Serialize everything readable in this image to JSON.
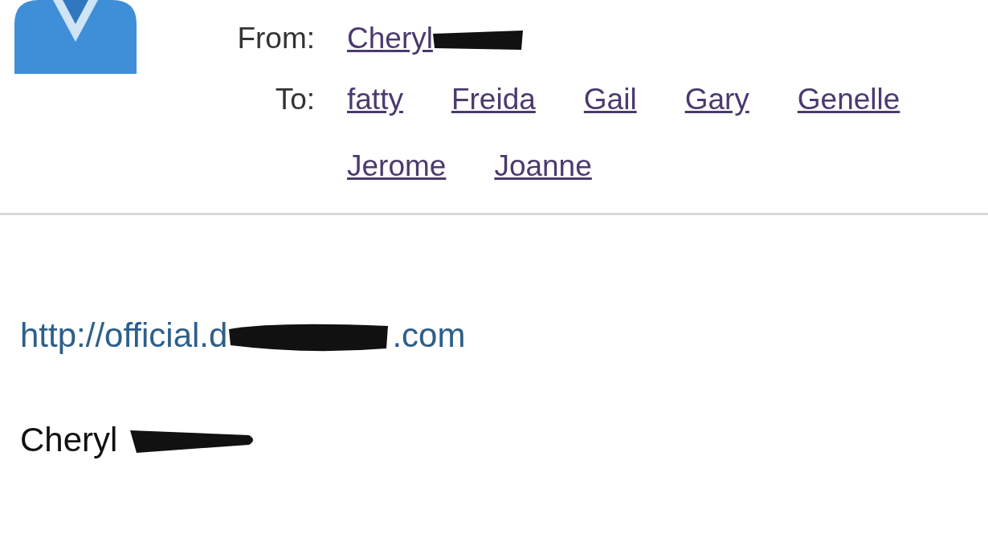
{
  "header": {
    "from": {
      "label": "From:",
      "name": "Cheryl"
    },
    "to": {
      "label": "To:",
      "recipients": [
        "fatty",
        "Freida",
        "Gail",
        "Gary",
        "Genelle",
        "Jerome",
        "Joanne"
      ]
    }
  },
  "body": {
    "link_start": "http://official.d",
    "link_end": ".com",
    "signature": "Cheryl"
  }
}
